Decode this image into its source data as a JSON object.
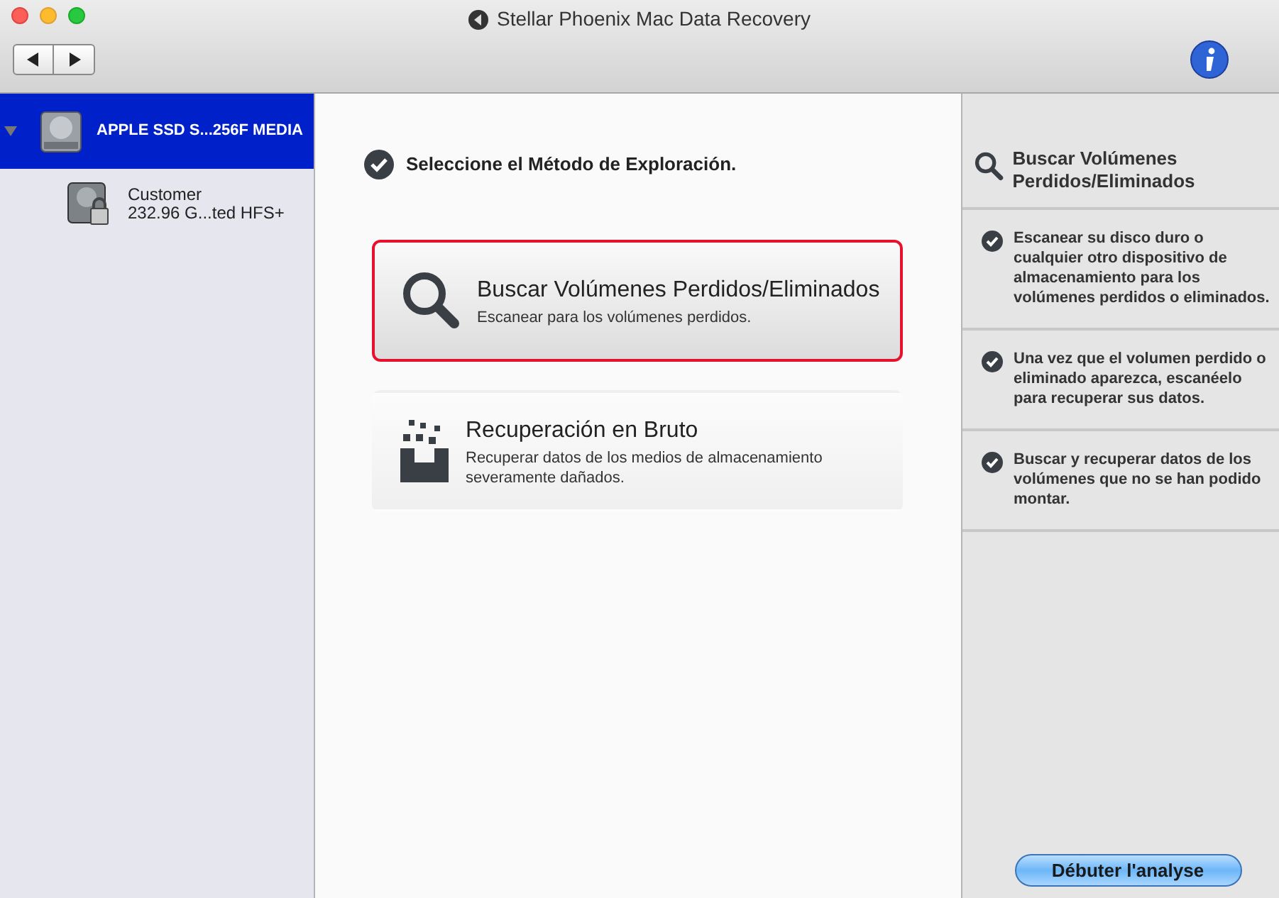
{
  "window": {
    "title": "Stellar Phoenix Mac Data Recovery"
  },
  "sidebar": {
    "items": [
      {
        "label": "APPLE SSD S...256F MEDIA",
        "selected": true,
        "expanded": true,
        "kind": "disk",
        "children": [
          {
            "label": "Customer",
            "detail": "232.96 G...ted HFS+",
            "selected": false,
            "kind": "volume"
          }
        ]
      }
    ]
  },
  "main": {
    "heading": "Seleccione el Método de Exploración.",
    "methods": [
      {
        "kind": "search",
        "title": "Buscar Volúmenes Perdidos/Eliminados",
        "description": "Escanear para los volúmenes perdidos.",
        "selected": true
      },
      {
        "kind": "raw",
        "title": "Recuperación en Bruto",
        "description": "Recuperar datos de los medios de almacenamiento severamente dañados.",
        "selected": false
      }
    ]
  },
  "info_panel": {
    "title": "Buscar Volúmenes Perdidos/Eliminados",
    "points": [
      "Escanear su disco duro o cualquier otro dispositivo de almacenamiento para los volúmenes perdidos o eliminados.",
      "Una vez que el volumen perdido o eliminado aparezca, escanéelo para recuperar sus datos.",
      "Buscar y recuperar datos de los volúmenes que no se han podido montar."
    ]
  },
  "start_button": "Débuter l'analyse"
}
